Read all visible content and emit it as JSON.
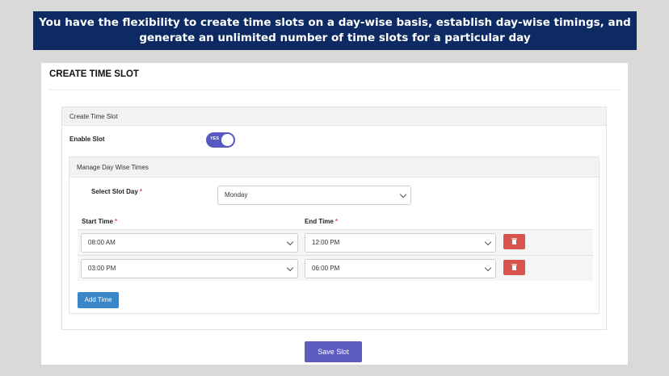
{
  "banner": {
    "line1": "You have the flexibility to create time slots on a day-wise basis, establish day-wise timings, and",
    "line2": "generate an unlimited number of time slots for a particular day"
  },
  "card": {
    "title": "CREATE TIME SLOT"
  },
  "panel": {
    "title": "Create Time Slot",
    "enable_label": "Enable Slot",
    "toggle_text": "YES",
    "toggle_on": true
  },
  "day_section": {
    "title": "Manage Day Wise Times",
    "slot_day_label": "Select Slot Day",
    "slot_day_value": "Monday",
    "start_label": "Start Time",
    "end_label": "End Time",
    "required_mark": "*",
    "rows": [
      {
        "start": "08:00 AM",
        "end": "12:00 PM"
      },
      {
        "start": "03:00 PM",
        "end": "06:00 PM"
      }
    ],
    "add_button": "Add Time"
  },
  "save_button": "Save Slot",
  "colors": {
    "banner_bg": "#0e2a63",
    "toggle": "#5758c3",
    "delete": "#d9534f",
    "add": "#3a86c8",
    "save": "#5c5cc3"
  },
  "icons": {
    "delete": "trash-icon",
    "dropdown": "chevron-down-icon"
  }
}
